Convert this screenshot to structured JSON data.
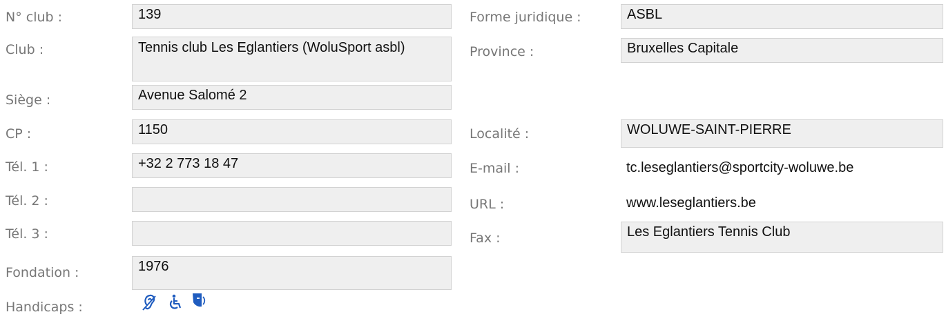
{
  "left": {
    "club_number": {
      "label": "N° club :",
      "value": "139"
    },
    "club": {
      "label": "Club :",
      "value": "Tennis club Les Eglantiers (WoluSport asbl)"
    },
    "siege": {
      "label": "Siège :",
      "value": "Avenue Salomé 2"
    },
    "cp": {
      "label": "CP :",
      "value": "1150"
    },
    "tel1": {
      "label": "Tél. 1 :",
      "value": "+32 2 773 18 47"
    },
    "tel2": {
      "label": "Tél. 2 :",
      "value": ""
    },
    "tel3": {
      "label": "Tél. 3 :",
      "value": ""
    },
    "fondation": {
      "label": "Fondation :",
      "value": "1976"
    },
    "handicaps": {
      "label": "Handicaps :",
      "icons": [
        "hearing-impaired-icon",
        "wheelchair-icon",
        "visually-impaired-icon"
      ]
    }
  },
  "right": {
    "forme": {
      "label": "Forme juridique :",
      "value": "ASBL"
    },
    "province": {
      "label": "Province :",
      "value": "Bruxelles Capitale"
    },
    "localite": {
      "label": "Localité :",
      "value": "WOLUWE-SAINT-PIERRE"
    },
    "email": {
      "label": "E-mail :",
      "value": "tc.leseglantiers@sportcity-woluwe.be"
    },
    "url": {
      "label": "URL :",
      "value": "www.leseglantiers.be"
    },
    "fax": {
      "label": "Fax :",
      "value": "Les Eglantiers Tennis Club"
    }
  },
  "colors": {
    "icon_blue": "#1f5cbf",
    "field_bg": "#efefef",
    "label_gray": "#777777"
  }
}
